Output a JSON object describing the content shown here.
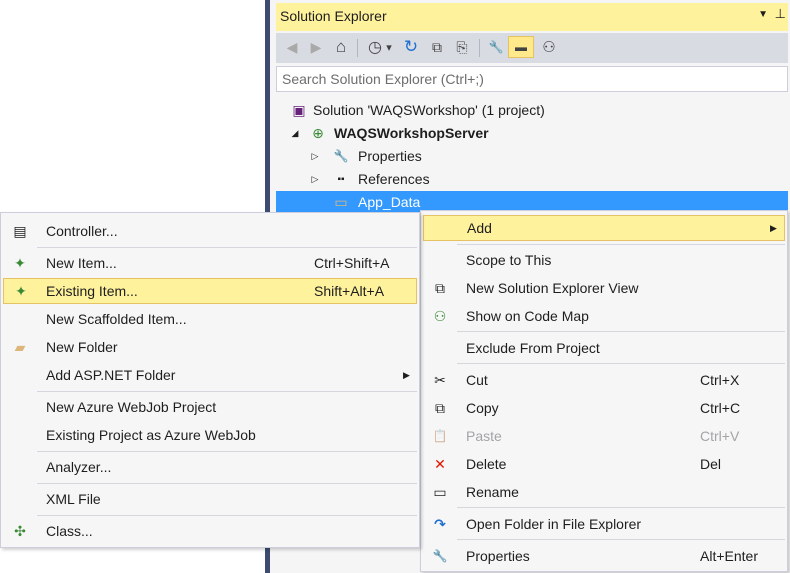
{
  "solution_explorer": {
    "title": "Solution Explorer",
    "title_pin_glyph": "▼",
    "title_close_glyph": "⊥",
    "search_placeholder": "Search Solution Explorer (Ctrl+;)",
    "toolbar": [
      {
        "name": "back-icon",
        "glyph": "◀",
        "disabled": true
      },
      {
        "name": "forward-icon",
        "glyph": "▶",
        "disabled": true
      },
      {
        "name": "home-icon",
        "glyph": "⌂",
        "disabled": false
      },
      {
        "name": "pending-changes-filter-icon",
        "glyph": "◷",
        "disabled": false
      },
      {
        "name": "dropdown-arrow-icon",
        "glyph": "▾",
        "disabled": false
      },
      {
        "name": "sync-icon",
        "glyph": "↻",
        "disabled": false
      },
      {
        "name": "collapse-all-icon",
        "glyph": "⧉",
        "disabled": false
      },
      {
        "name": "show-all-files-icon",
        "glyph": "⎘",
        "disabled": false
      },
      {
        "name": "properties-wrench-icon",
        "glyph": "🔧",
        "disabled": false
      },
      {
        "name": "preview-selected-icon",
        "glyph": "▬",
        "disabled": false,
        "active": true
      },
      {
        "name": "code-map-icon",
        "glyph": "⚇",
        "disabled": false
      }
    ],
    "tree": [
      {
        "label": "Solution 'WAQSWorkshop' (1 project)",
        "icon": "solution-icon",
        "icon_glyph": "▣",
        "expander": "",
        "bold": false
      },
      {
        "label": "WAQSWorkshopServer",
        "icon": "web-project-icon",
        "icon_glyph": "⊕",
        "expander": "◢",
        "bold": true
      },
      {
        "label": "Properties",
        "icon": "wrench-icon",
        "icon_glyph": "🔧",
        "expander": "▷",
        "bold": false
      },
      {
        "label": "References",
        "icon": "references-icon",
        "icon_glyph": "▪▪",
        "expander": "▷",
        "bold": false
      },
      {
        "label": "App_Data",
        "icon": "folder-icon",
        "icon_glyph": "▭",
        "expander": "",
        "bold": false,
        "selected": true
      }
    ]
  },
  "main_menu": {
    "items": [
      {
        "icon": "scope-icon",
        "glyph": "⊡",
        "label": "Add",
        "shortcut": "",
        "submenu": true,
        "highlighted": true,
        "disabled": false
      },
      {
        "icon": "",
        "glyph": "",
        "label": "Scope to This",
        "shortcut": "",
        "submenu": false,
        "highlighted": false,
        "disabled": false
      },
      {
        "icon": "new-view-icon",
        "glyph": "⧉",
        "label": "New Solution Explorer View",
        "shortcut": "",
        "submenu": false,
        "highlighted": false,
        "disabled": false
      },
      {
        "icon": "code-map-icon",
        "glyph": "⚇",
        "label": "Show on Code Map",
        "shortcut": "",
        "submenu": false,
        "highlighted": false,
        "disabled": false
      },
      {
        "icon": "",
        "glyph": "",
        "label": "Exclude From Project",
        "shortcut": "",
        "submenu": false,
        "highlighted": false,
        "disabled": false
      },
      {
        "icon": "cut-icon",
        "glyph": "✂",
        "label": "Cut",
        "shortcut": "Ctrl+X",
        "submenu": false,
        "highlighted": false,
        "disabled": false
      },
      {
        "icon": "copy-icon",
        "glyph": "⧉",
        "label": "Copy",
        "shortcut": "Ctrl+C",
        "submenu": false,
        "highlighted": false,
        "disabled": false
      },
      {
        "icon": "paste-icon",
        "glyph": "📋",
        "label": "Paste",
        "shortcut": "Ctrl+V",
        "submenu": false,
        "highlighted": false,
        "disabled": true
      },
      {
        "icon": "delete-icon",
        "glyph": "✕",
        "label": "Delete",
        "shortcut": "Del",
        "submenu": false,
        "highlighted": false,
        "disabled": false
      },
      {
        "icon": "rename-icon",
        "glyph": "▭",
        "label": "Rename",
        "shortcut": "",
        "submenu": false,
        "highlighted": false,
        "disabled": false
      },
      {
        "icon": "open-folder-icon",
        "glyph": "↷",
        "label": "Open Folder in File Explorer",
        "shortcut": "",
        "submenu": false,
        "highlighted": false,
        "disabled": false
      },
      {
        "icon": "properties-icon",
        "glyph": "🔧",
        "label": "Properties",
        "shortcut": "Alt+Enter",
        "submenu": false,
        "highlighted": false,
        "disabled": false
      }
    ]
  },
  "add_submenu": {
    "items": [
      {
        "icon": "controller-icon",
        "glyph": "▤",
        "label": "Controller...",
        "shortcut": "",
        "submenu": false,
        "highlighted": false
      },
      {
        "icon": "new-item-icon",
        "glyph": "✦",
        "label": "New Item...",
        "shortcut": "Ctrl+Shift+A",
        "submenu": false,
        "highlighted": false
      },
      {
        "icon": "existing-item-icon",
        "glyph": "✦",
        "label": "Existing Item...",
        "shortcut": "Shift+Alt+A",
        "submenu": false,
        "highlighted": true
      },
      {
        "icon": "",
        "glyph": "",
        "label": "New Scaffolded Item...",
        "shortcut": "",
        "submenu": false,
        "highlighted": false
      },
      {
        "icon": "new-folder-icon",
        "glyph": "▰",
        "label": "New Folder",
        "shortcut": "",
        "submenu": false,
        "highlighted": false
      },
      {
        "icon": "",
        "glyph": "",
        "label": "Add ASP.NET Folder",
        "shortcut": "",
        "submenu": true,
        "highlighted": false
      },
      {
        "icon": "",
        "glyph": "",
        "label": "New Azure WebJob Project",
        "shortcut": "",
        "submenu": false,
        "highlighted": false
      },
      {
        "icon": "",
        "glyph": "",
        "label": "Existing Project as Azure WebJob",
        "shortcut": "",
        "submenu": false,
        "highlighted": false
      },
      {
        "icon": "",
        "glyph": "",
        "label": "Analyzer...",
        "shortcut": "",
        "submenu": false,
        "highlighted": false
      },
      {
        "icon": "",
        "glyph": "",
        "label": "XML File",
        "shortcut": "",
        "submenu": false,
        "highlighted": false
      },
      {
        "icon": "class-icon",
        "glyph": "✣",
        "label": "Class...",
        "shortcut": "",
        "submenu": false,
        "highlighted": false
      }
    ]
  },
  "colors": {
    "title_highlight": "#fff29d",
    "selection_blue": "#3399ff",
    "delete_red": "#e51400",
    "open_folder_blue": "#1e6fd0"
  }
}
